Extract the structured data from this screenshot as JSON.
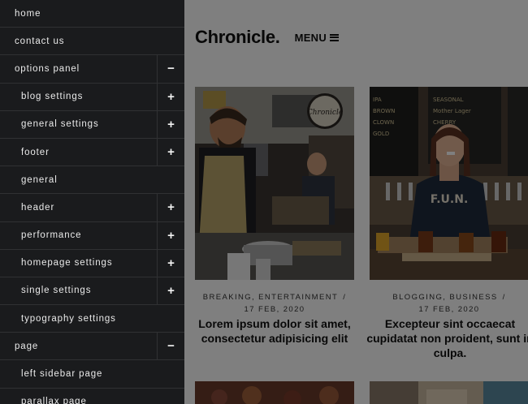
{
  "site": {
    "title": "Chronicle.",
    "menu_label": "MENU"
  },
  "posts": [
    {
      "categories": "BREAKING, ENTERTAINMENT",
      "separator": "/",
      "date": "17 FEB, 2020",
      "title": "Lorem ipsum dolor sit amet, consectetur adipisicing elit",
      "image": "photo-bartender-market"
    },
    {
      "categories": "BLOGGING, BUSINESS",
      "separator": "/",
      "date": "17 FEB, 2020",
      "title": "Excepteur sint occaecat cupidatat non proident, sunt in culpa.",
      "image": "photo-woman-brewery"
    }
  ],
  "nav": {
    "items": [
      {
        "label": "home",
        "level": 0,
        "toggle": ""
      },
      {
        "label": "contact us",
        "level": 0,
        "toggle": ""
      },
      {
        "label": "options panel",
        "level": 0,
        "toggle": "−"
      },
      {
        "label": "blog settings",
        "level": 1,
        "toggle": "+"
      },
      {
        "label": "general settings",
        "level": 1,
        "toggle": "+"
      },
      {
        "label": "footer",
        "level": 1,
        "toggle": "+"
      },
      {
        "label": "general",
        "level": 1,
        "toggle": ""
      },
      {
        "label": "header",
        "level": 1,
        "toggle": "+"
      },
      {
        "label": "performance",
        "level": 1,
        "toggle": "+"
      },
      {
        "label": "homepage settings",
        "level": 1,
        "toggle": "+"
      },
      {
        "label": "single settings",
        "level": 1,
        "toggle": "+"
      },
      {
        "label": "typography settings",
        "level": 1,
        "toggle": ""
      },
      {
        "label": "page",
        "level": 0,
        "toggle": "−"
      },
      {
        "label": "left sidebar page",
        "level": 1,
        "toggle": ""
      },
      {
        "label": "parallax page",
        "level": 1,
        "toggle": ""
      }
    ]
  },
  "colors": {
    "nav_bg": "#1a1b1d",
    "overlay": "rgba(0,0,0,0.5)"
  }
}
